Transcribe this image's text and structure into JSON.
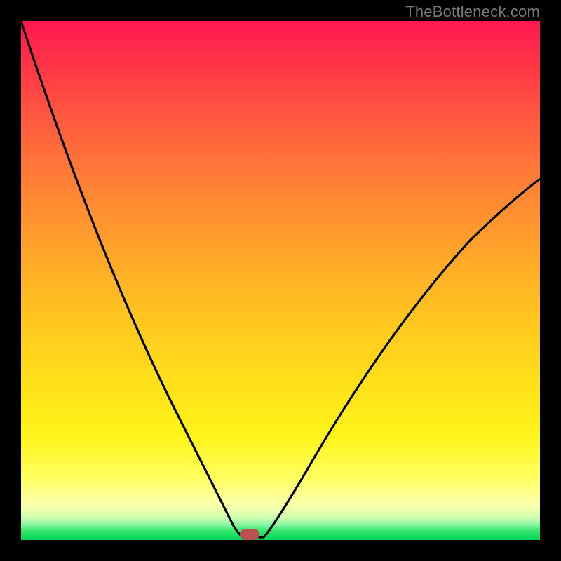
{
  "watermark": "TheBottleneck.com",
  "colors": {
    "frame": "#000000",
    "gradient_top": "#ff1850",
    "gradient_bottom": "#00d65a",
    "curve": "#000000",
    "marker": "#b9524f",
    "watermark": "#7a7a7a"
  },
  "chart_data": {
    "type": "line",
    "title": "",
    "xlabel": "",
    "ylabel": "",
    "xlim": [
      0,
      100
    ],
    "ylim": [
      0,
      100
    ],
    "x": [
      0,
      5,
      10,
      15,
      20,
      25,
      30,
      35,
      38,
      40,
      42,
      43,
      44,
      46,
      50,
      55,
      60,
      65,
      70,
      75,
      80,
      85,
      90,
      95,
      100
    ],
    "values": [
      100,
      85,
      71,
      58,
      46,
      35,
      25,
      16,
      9,
      5,
      2,
      1,
      0,
      0,
      4,
      11,
      19,
      27,
      34,
      41,
      48,
      54,
      60,
      65,
      70
    ],
    "minimum_marker": {
      "x": 44,
      "y": 0
    },
    "annotations": []
  }
}
